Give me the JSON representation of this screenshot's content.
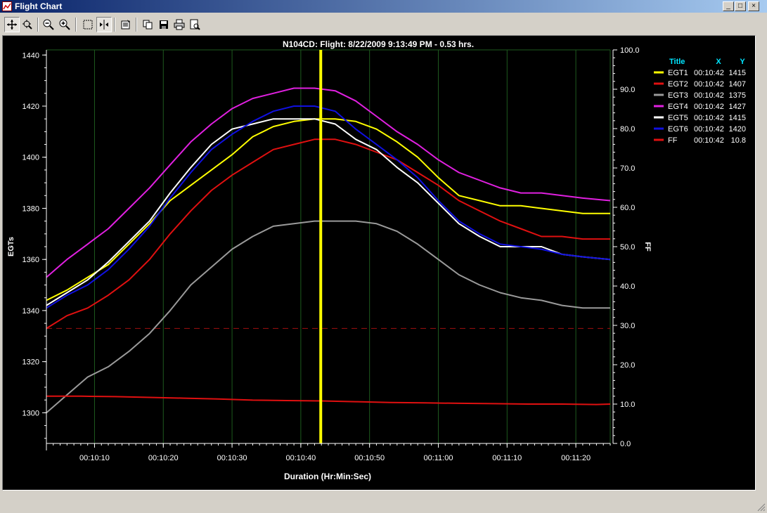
{
  "window": {
    "title": "Flight Chart",
    "minimize": "_",
    "maximize": "□",
    "close": "×"
  },
  "toolbar": {
    "buttons": [
      {
        "icon": "pan-icon",
        "pressed": true
      },
      {
        "icon": "zoom-box-icon",
        "pressed": false
      },
      {
        "icon": "zoom-out-icon",
        "pressed": false
      },
      {
        "icon": "zoom-in-icon",
        "pressed": false
      },
      {
        "icon": "select-box-icon",
        "pressed": false
      },
      {
        "icon": "cursor-icon",
        "pressed": true
      },
      {
        "icon": "properties-icon",
        "pressed": false
      },
      {
        "icon": "copy-icon",
        "pressed": false
      },
      {
        "icon": "save-icon",
        "pressed": false
      },
      {
        "icon": "print-icon",
        "pressed": false
      },
      {
        "icon": "print-preview-icon",
        "pressed": false
      }
    ]
  },
  "chart_data": {
    "type": "line",
    "title": "N104CD:  Flight: 8/22/2009 9:13:49 PM  - 0.53 hrs.",
    "xlabel": "Duration (Hr:Min:Sec)",
    "ylabel": "EGTs",
    "y2label": "FF",
    "x_ticks": [
      "00:10:10",
      "00:10:20",
      "00:10:30",
      "00:10:40",
      "00:10:50",
      "00:11:00",
      "00:11:10",
      "00:11:20"
    ],
    "x_tick_seconds": [
      610,
      620,
      630,
      640,
      650,
      660,
      670,
      680
    ],
    "xlim": [
      603,
      685
    ],
    "ylim": [
      1288,
      1442
    ],
    "y_ticks": [
      1300,
      1320,
      1340,
      1360,
      1380,
      1400,
      1420,
      1440
    ],
    "y2lim": [
      0,
      100
    ],
    "y2_ticks": [
      "0.0",
      "10.0",
      "20.0",
      "30.0",
      "40.0",
      "50.0",
      "60.0",
      "70.0",
      "80.0",
      "90.0",
      "100.0"
    ],
    "cursor_x": 642.9,
    "cursor_label": "00:10:42",
    "dashed_reference_y": 1333,
    "grid": true,
    "legend_position": "right",
    "legend_header": {
      "title": "Title",
      "x": "X",
      "y": "Y"
    },
    "series": [
      {
        "name": "EGT1",
        "color": "#ffff00",
        "cursor_x": "00:10:42",
        "cursor_y": "1415",
        "axis": "left",
        "x": [
          603,
          606,
          609,
          612,
          615,
          618,
          621,
          624,
          627,
          630,
          633,
          636,
          639,
          642,
          645,
          648,
          651,
          654,
          657,
          660,
          663,
          666,
          669,
          672,
          675,
          678,
          681,
          685
        ],
        "y": [
          1344,
          1348,
          1353,
          1358,
          1366,
          1374,
          1383,
          1389,
          1395,
          1401,
          1408,
          1412,
          1414,
          1415,
          1415,
          1414,
          1411,
          1406,
          1400,
          1392,
          1385,
          1383,
          1381,
          1381,
          1380,
          1379,
          1378,
          1378
        ]
      },
      {
        "name": "EGT2",
        "color": "#e01010",
        "cursor_x": "00:10:42",
        "cursor_y": "1407",
        "axis": "left",
        "x": [
          603,
          606,
          609,
          612,
          615,
          618,
          621,
          624,
          627,
          630,
          633,
          636,
          639,
          642,
          645,
          648,
          651,
          654,
          657,
          660,
          663,
          666,
          669,
          672,
          675,
          678,
          681,
          685
        ],
        "y": [
          1333,
          1338,
          1341,
          1346,
          1352,
          1360,
          1370,
          1379,
          1387,
          1393,
          1398,
          1403,
          1405,
          1407,
          1407,
          1405,
          1402,
          1399,
          1394,
          1389,
          1383,
          1379,
          1375,
          1372,
          1369,
          1369,
          1368,
          1368
        ]
      },
      {
        "name": "EGT3",
        "color": "#9a9a9a",
        "cursor_x": "00:10:42",
        "cursor_y": "1375",
        "axis": "left",
        "x": [
          603,
          606,
          609,
          612,
          615,
          618,
          621,
          624,
          627,
          630,
          633,
          636,
          639,
          642,
          645,
          648,
          651,
          654,
          657,
          660,
          663,
          666,
          669,
          672,
          675,
          678,
          681,
          685
        ],
        "y": [
          1300,
          1307,
          1314,
          1318,
          1324,
          1331,
          1340,
          1350,
          1357,
          1364,
          1369,
          1373,
          1374,
          1375,
          1375,
          1375,
          1374,
          1371,
          1366,
          1360,
          1354,
          1350,
          1347,
          1345,
          1344,
          1342,
          1341,
          1341
        ]
      },
      {
        "name": "EGT4",
        "color": "#e020e0",
        "cursor_x": "00:10:42",
        "cursor_y": "1427",
        "axis": "left",
        "x": [
          603,
          606,
          609,
          612,
          615,
          618,
          621,
          624,
          627,
          630,
          633,
          636,
          639,
          642,
          645,
          648,
          651,
          654,
          657,
          660,
          663,
          666,
          669,
          672,
          675,
          678,
          681,
          685
        ],
        "y": [
          1353,
          1360,
          1366,
          1372,
          1380,
          1388,
          1397,
          1406,
          1413,
          1419,
          1423,
          1425,
          1427,
          1427,
          1426,
          1422,
          1416,
          1410,
          1405,
          1399,
          1394,
          1391,
          1388,
          1386,
          1386,
          1385,
          1384,
          1383
        ]
      },
      {
        "name": "EGT5",
        "color": "#ffffff",
        "cursor_x": "00:10:42",
        "cursor_y": "1415",
        "axis": "left",
        "x": [
          603,
          606,
          609,
          612,
          615,
          618,
          621,
          624,
          627,
          630,
          633,
          636,
          639,
          642,
          645,
          648,
          651,
          654,
          657,
          660,
          663,
          666,
          669,
          672,
          675,
          678,
          681,
          685
        ],
        "y": [
          1342,
          1347,
          1352,
          1359,
          1367,
          1375,
          1386,
          1396,
          1405,
          1411,
          1413,
          1415,
          1415,
          1415,
          1413,
          1407,
          1403,
          1396,
          1390,
          1382,
          1374,
          1369,
          1365,
          1365,
          1365,
          1362,
          1361,
          1360
        ]
      },
      {
        "name": "EGT6",
        "color": "#1010e0",
        "cursor_x": "00:10:42",
        "cursor_y": "1420",
        "axis": "left",
        "x": [
          603,
          606,
          609,
          612,
          615,
          618,
          621,
          624,
          627,
          630,
          633,
          636,
          639,
          642,
          645,
          648,
          651,
          654,
          657,
          660,
          663,
          666,
          669,
          672,
          675,
          678,
          681,
          685
        ],
        "y": [
          1341,
          1346,
          1350,
          1356,
          1364,
          1373,
          1384,
          1394,
          1403,
          1409,
          1414,
          1418,
          1420,
          1420,
          1418,
          1411,
          1405,
          1399,
          1392,
          1383,
          1375,
          1370,
          1366,
          1365,
          1364,
          1362,
          1361,
          1360
        ]
      },
      {
        "name": "FF",
        "color": "#e01010",
        "cursor_x": "00:10:42",
        "cursor_y": "10.8",
        "axis": "right",
        "x": [
          603,
          608,
          613,
          618,
          623,
          628,
          633,
          638,
          643,
          648,
          653,
          658,
          663,
          668,
          673,
          678,
          683,
          685
        ],
        "y": [
          12.0,
          12.0,
          11.9,
          11.7,
          11.5,
          11.3,
          11.0,
          10.9,
          10.8,
          10.6,
          10.4,
          10.3,
          10.2,
          10.1,
          10.0,
          10.0,
          9.9,
          10.0
        ]
      }
    ]
  }
}
